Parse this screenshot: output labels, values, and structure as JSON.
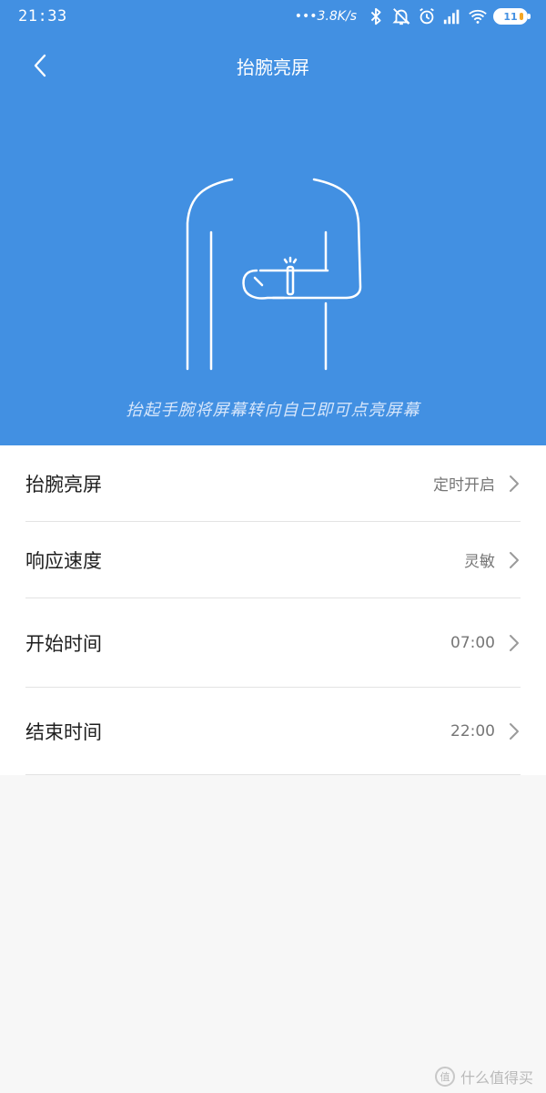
{
  "status_bar": {
    "time": "21:33",
    "net_speed": "3.8K/s",
    "battery": "11"
  },
  "nav": {
    "title": "抬腕亮屏"
  },
  "banner": {
    "hint": "抬起手腕将屏幕转向自己即可点亮屏幕"
  },
  "settings": [
    {
      "label": "抬腕亮屏",
      "value": "定时开启"
    },
    {
      "label": "响应速度",
      "value": "灵敏"
    },
    {
      "label": "开始时间",
      "value": "07:00"
    },
    {
      "label": "结束时间",
      "value": "22:00"
    }
  ],
  "watermark": {
    "text": "什么值得买"
  },
  "colors": {
    "header_bg": "#4290e2",
    "list_bg": "#ffffff",
    "page_bg": "#f7f7f7"
  }
}
